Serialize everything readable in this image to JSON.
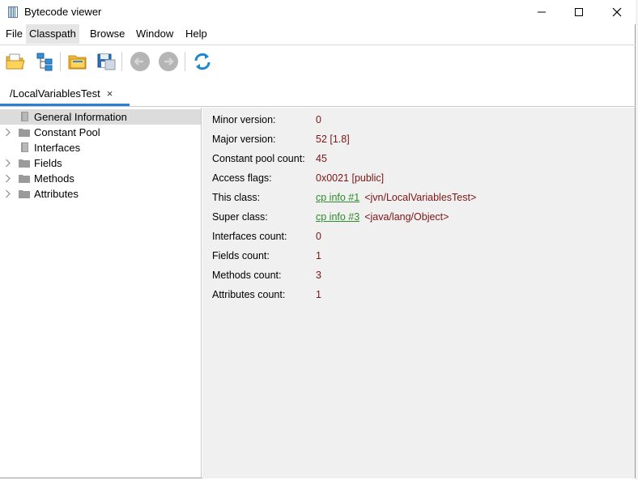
{
  "window": {
    "title": "Bytecode viewer"
  },
  "menu": [
    "File",
    "Classpath",
    "Browse",
    "Window",
    "Help"
  ],
  "toolbar": {
    "buttons": [
      "open-folder-icon",
      "classpath-tree-icon",
      "open-directory-icon",
      "save-icon",
      "back-icon",
      "forward-icon",
      "refresh-icon"
    ]
  },
  "tab": {
    "label": "/LocalVariablesTest",
    "close": "×"
  },
  "tree": [
    {
      "label": "General Information",
      "expandable": false,
      "selected": true
    },
    {
      "label": "Constant Pool",
      "expandable": true,
      "selected": false
    },
    {
      "label": "Interfaces",
      "expandable": false,
      "selected": false
    },
    {
      "label": "Fields",
      "expandable": true,
      "selected": false
    },
    {
      "label": "Methods",
      "expandable": true,
      "selected": false
    },
    {
      "label": "Attributes",
      "expandable": true,
      "selected": false
    }
  ],
  "info": {
    "minor_version": {
      "label": "Minor version:",
      "value": "0"
    },
    "major_version": {
      "label": "Major version:",
      "value": "52 [1.8]"
    },
    "constant_pool_count": {
      "label": "Constant pool count:",
      "value": "45"
    },
    "access_flags": {
      "label": "Access flags:",
      "value": "0x0021 [public]"
    },
    "this_class": {
      "label": "This class:",
      "link": "cp info #1",
      "extra": "<jvn/LocalVariablesTest>"
    },
    "super_class": {
      "label": "Super class:",
      "link": "cp info #3",
      "extra": "<java/lang/Object>"
    },
    "interfaces_count": {
      "label": "Interfaces count:",
      "value": "0"
    },
    "fields_count": {
      "label": "Fields count:",
      "value": "1"
    },
    "methods_count": {
      "label": "Methods count:",
      "value": "3"
    },
    "attributes_count": {
      "label": "Attributes count:",
      "value": "1"
    }
  },
  "colors": {
    "value": "#7a1515",
    "link": "#2e8b2e",
    "tab_accent": "#2a7fd4",
    "selection": "#dcdcdc"
  }
}
